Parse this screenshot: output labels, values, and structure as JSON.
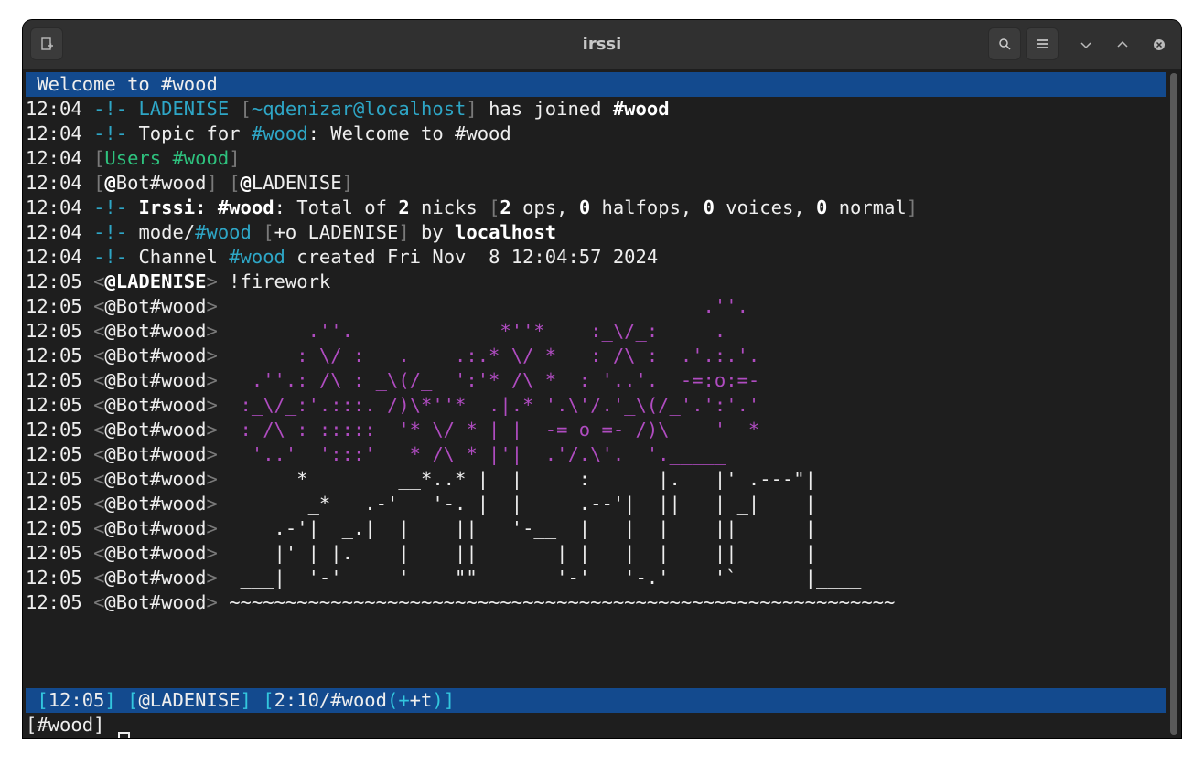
{
  "window": {
    "title": "irssi"
  },
  "topic_bar": "Welcome to #wood",
  "lines": [
    {
      "time": "12:04",
      "kind": "join",
      "nick": "LADENISE",
      "host": "~qdenizar@localhost",
      "text": "has joined",
      "channel": "#wood"
    },
    {
      "time": "12:04",
      "kind": "topic",
      "pre": "Topic for ",
      "channel": "#wood",
      "text": ": Welcome to #wood"
    },
    {
      "time": "12:04",
      "kind": "users",
      "label": "Users ",
      "channel": "#wood"
    },
    {
      "time": "12:04",
      "kind": "userlist",
      "u1": "Bot#wood",
      "u2": "LADENISE"
    },
    {
      "time": "12:04",
      "kind": "total",
      "irssi": "Irssi:",
      "channel": "#wood",
      "t1": ": Total of ",
      "n": "2",
      "t2": " nicks ",
      "ops": "2",
      "t3": " ops, ",
      "halfops": "0",
      "t4": " halfops, ",
      "voices": "0",
      "t5": " voices, ",
      "normal": "0",
      "t6": " normal"
    },
    {
      "time": "12:04",
      "kind": "mode",
      "pre": "mode/",
      "channel": "#wood",
      "mode": "+o LADENISE",
      "by": " by ",
      "who": "localhost"
    },
    {
      "time": "12:04",
      "kind": "created",
      "pre": "Channel ",
      "channel": "#wood",
      "text": " created Fri Nov  8 12:04:57 2024"
    },
    {
      "time": "12:05",
      "kind": "msg",
      "nick": "LADENISE",
      "text": " !firework"
    }
  ],
  "bot_nick": "Bot#wood",
  "art": [
    "                                          .''.",
    "       .''.             *''*    :_\\/_:     .",
    "      :_\\/_:   .    .:.*_\\/_*   : /\\ :  .'.:.'.",
    "  .''.: /\\ : _\\(/_  ':'* /\\ *  : '..'.  -=:o:=-",
    " :_\\/_:'.:::. /)\\*''*  .|.* '.\\'/.'_\\(/_'.':'.'",
    " : /\\ : :::::  '*_\\/_* | |  -= o =- /)\\    '  *",
    "  '..'  ':::'   * /\\ * |'|  .'/.\\'.  '._____",
    "      *        __*..* |  |     :      |.   |' .---\"|",
    "       _*   .-'   '-. |  |     .--'|  ||   | _|    |",
    "    .-'|  _.|  |    ||   '-__  |   |  |    ||      |",
    "    |' | |.    |    ||       | |   |  |    ||      |",
    " ___|  '-'     '    \"\"       '-'   '-.'    '`      |____",
    "~~~~~~~~~~~~~~~~~~~~~~~~~~~~~~~~~~~~~~~~~~~~~~~~~~~~~~~~~~~"
  ],
  "art_time": "12:05",
  "status_bar": {
    "time": "12:05",
    "nick": "@LADENISE",
    "window": "2:10/#wood",
    "mode": "+t"
  },
  "prompt": "[#wood] "
}
